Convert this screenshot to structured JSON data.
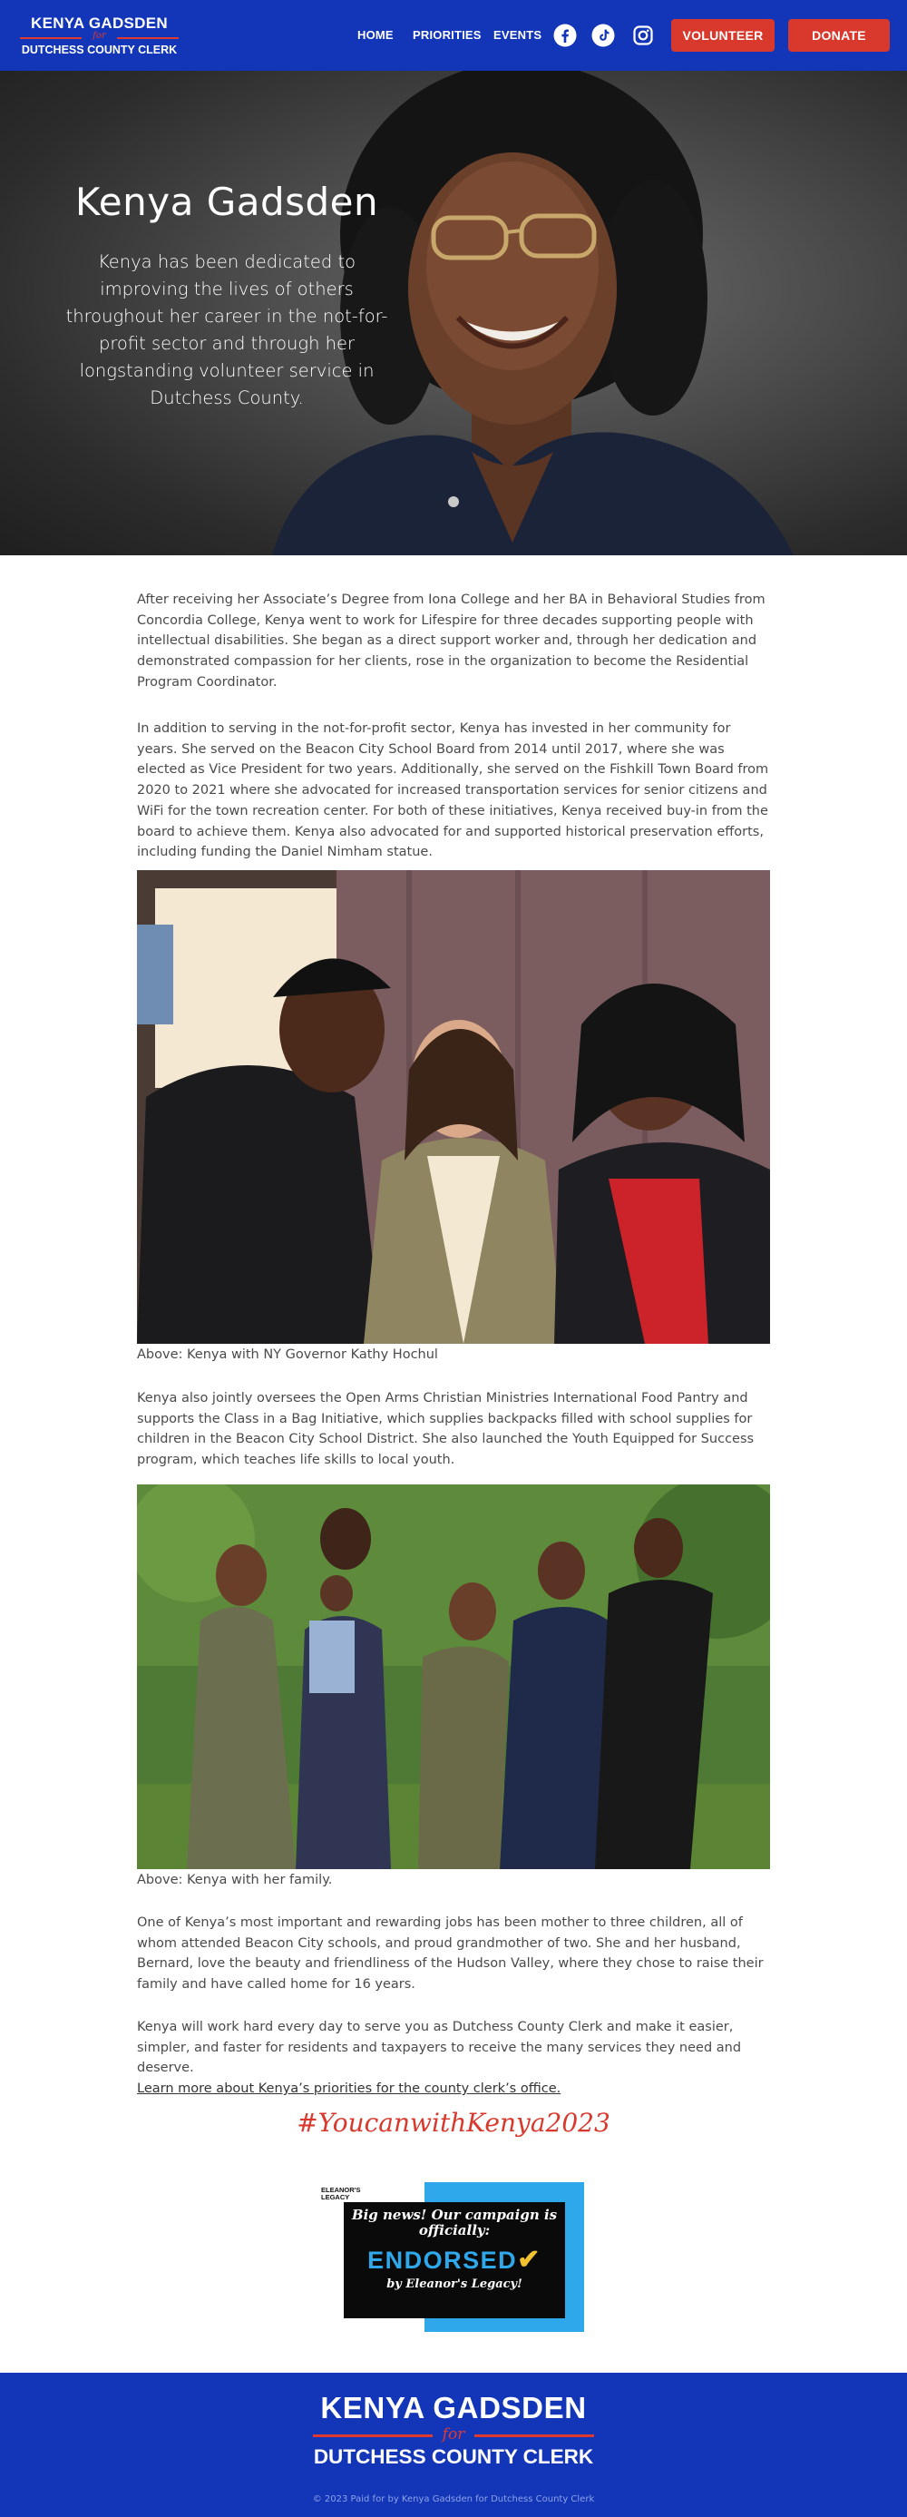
{
  "header": {
    "logo": {
      "line1": "KENYA GADSDEN",
      "for": "for",
      "line2": "DUTCHESS COUNTY CLERK"
    },
    "nav": [
      "HOME",
      "PRIORITIES",
      "EVENTS"
    ],
    "social_icons": [
      "facebook-icon",
      "tiktok-icon",
      "instagram-icon"
    ],
    "volunteer_label": "VOLUNTEER",
    "donate_label": "DONATE",
    "colors": {
      "header_bg": "#1336b9",
      "accent_red": "#d9392d"
    }
  },
  "hero": {
    "title": "Kenya Gadsden",
    "text": "Kenya has been dedicated to improving the lives of others throughout her career in the not-for-profit sector and through her longstanding volunteer service in Dutchess County."
  },
  "content": {
    "para1": "After receiving her Associate’s Degree from Iona College and her BA in Behavioral Studies from Concordia College, Kenya went to work for Lifespire for three decades supporting people with intellectual disabilities.  She began as a direct support worker and, through her dedication and demonstrated compassion for her clients, rose in the organization to become the Residential Program Coordinator.",
    "para2": "In addition to serving in the not-for-profit sector, Kenya has invested in her community for years. She served on the Beacon City School Board from 2014 until 2017, where she was elected as Vice President for two years.  Additionally, she served on the Fishkill Town Board from 2020 to 2021 where she advocated for increased transportation services for senior citizens and WiFi for the town recreation center.  For both of these initiatives, Kenya received buy-in from the board to achieve them.  Kenya also advocated for and supported historical preservation efforts, including funding the Daniel Nimham statue.",
    "caption1": "Above: Kenya with NY Governor Kathy Hochul",
    "para3": "Kenya also jointly oversees the Open Arms Christian Ministries International Food Pantry and supports the Class in a Bag Initiative, which supplies backpacks filled with school supplies for children in the Beacon City School District.  She also launched the Youth Equipped for Success program, which teaches life skills to local youth.",
    "caption2": "Above: Kenya with her family.",
    "para4": "One of Kenya’s most important and rewarding jobs has been mother to three children, all of whom attended Beacon City schools, and proud grandmother of two.  She and her husband, Bernard, love the beauty and friendliness of the Hudson Valley, where they chose to raise their family and have called home for 16 years.",
    "para5": "Kenya will work hard every day to serve you as Dutchess County Clerk and make it easier, simpler, and faster for residents and taxpayers to receive the many services they need and deserve.",
    "link": "Learn more about Kenya’s priorities for the county clerk’s office.",
    "hashtag": "#YoucanwithKenya2023"
  },
  "endorsement": {
    "org_logo": "ELEANOR'S LEGACY",
    "line1": "Big news! Our campaign is officially:",
    "line2": "ENDORSED",
    "line3": "by Eleanor's Legacy!"
  },
  "footer": {
    "line1": "KENYA GADSDEN",
    "for": "for",
    "line2": "DUTCHESS COUNTY CLERK",
    "copyright": "© 2023 Paid for by Kenya Gadsden for Dutchess County Clerk"
  }
}
